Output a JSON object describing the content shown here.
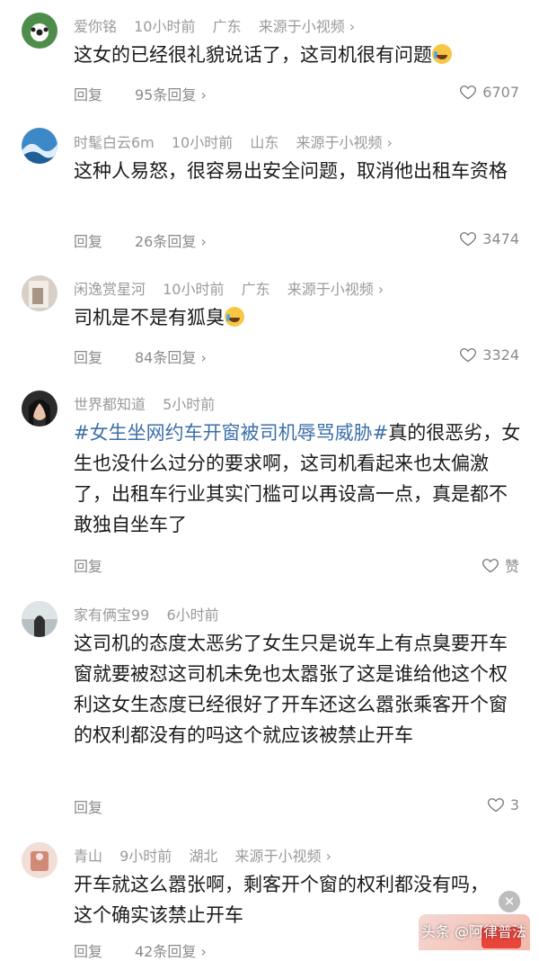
{
  "comments": [
    {
      "user": "爱你铭",
      "time": "10小时前",
      "location": "广东",
      "source": "来源于小视频",
      "text": "这女的已经很礼貌说话了，这司机很有问题",
      "emoji": true,
      "reply": "回复",
      "replies": "95条回复",
      "likes": "6707",
      "avatar_color": "#4e8c4a"
    },
    {
      "user": "时髦白云6m",
      "time": "10小时前",
      "location": "山东",
      "source": "来源于小视频",
      "text": "这种人易怒，很容易出安全问题，取消他出租车资格",
      "reply": "回复",
      "replies": "26条回复",
      "likes": "3474",
      "avatar_color": "#3d88c6"
    },
    {
      "user": "闲逸赏星河",
      "time": "10小时前",
      "location": "广东",
      "source": "来源于小视频",
      "text": "司机是不是有狐臭",
      "emoji": true,
      "reply": "回复",
      "replies": "84条回复",
      "likes": "3324",
      "avatar_color": "#b7a89a"
    },
    {
      "user": "世界都知道",
      "time": "5小时前",
      "hashtag": "#女生坐网约车开窗被司机辱骂威胁#",
      "text": "真的很恶劣，女生也没什么过分的要求啊，这司机看起来也太偏激了，出租车行业其实门槛可以再设高一点，真是都不敢独自坐车了",
      "reply": "回复",
      "likes": "赞",
      "avatar_color": "#2b2b2b"
    },
    {
      "user": "家有俩宝99",
      "time": "6小时前",
      "text": "这司机的态度太恶劣了女生只是说车上有点臭要开车窗就要被怼这司机未免也太嚣张了这是谁给他这个权利这女生态度已经很好了开车还这么嚣张乘客开个窗的权利都没有的吗这个就应该被禁止开车",
      "reply": "回复",
      "likes": "3",
      "avatar_color": "#7e8a8f"
    },
    {
      "user": "青山",
      "time": "9小时前",
      "location": "湖北",
      "source": "来源于小视频",
      "text": "开车就这么嚣张啊，剩客开个窗的权利都没有吗，这个确实该禁止开车",
      "reply": "回复",
      "replies": "42条回复",
      "avatar_color": "#d8a38f"
    }
  ],
  "watermark": "头条 @阿律普法",
  "ad_close": "✕"
}
